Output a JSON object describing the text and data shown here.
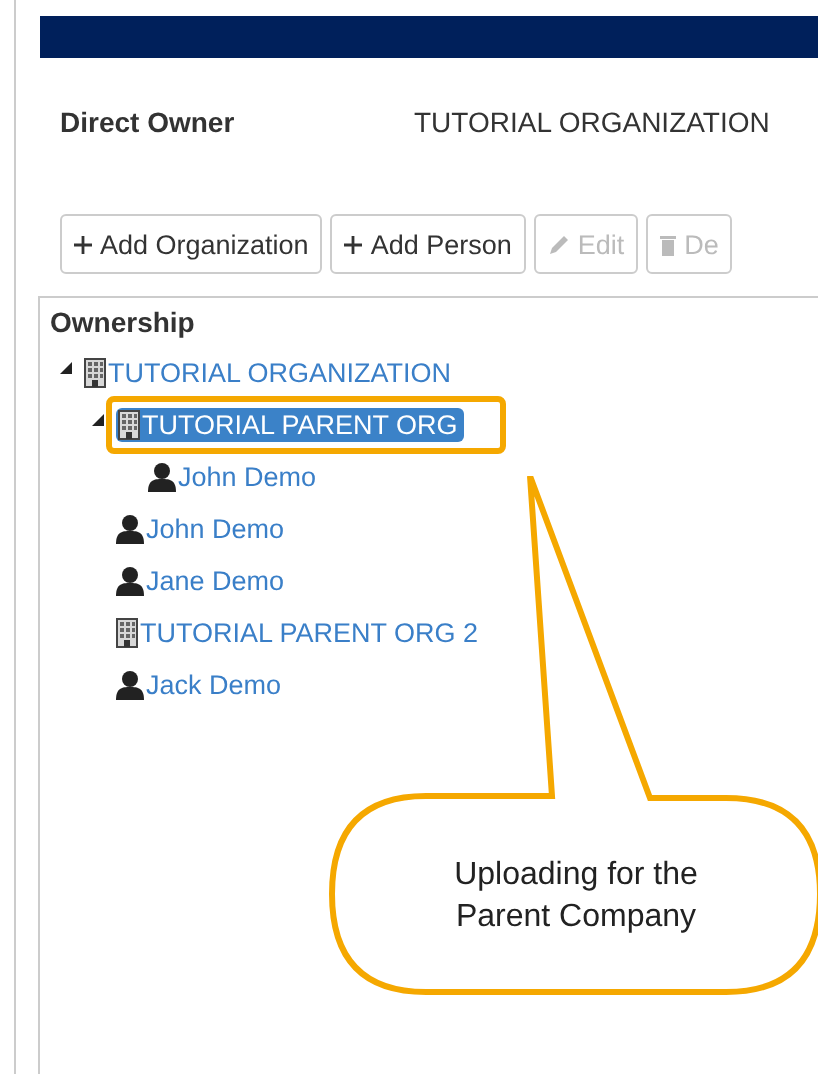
{
  "field": {
    "label": "Direct Owner",
    "value": "TUTORIAL ORGANIZATION"
  },
  "toolbar": [
    {
      "kind": "add",
      "label": "Add Organization",
      "disabled": false
    },
    {
      "kind": "add",
      "label": "Add Person",
      "disabled": false
    },
    {
      "kind": "edit",
      "label": "Edit",
      "disabled": true
    },
    {
      "kind": "delete",
      "label": "De",
      "disabled": true
    }
  ],
  "tree": {
    "title": "Ownership",
    "nodes": [
      {
        "kind": "org",
        "label": "TUTORIAL ORGANIZATION",
        "expanded": true,
        "selected": false,
        "highlighted": false,
        "children": [
          {
            "kind": "org",
            "label": "TUTORIAL PARENT ORG",
            "expanded": true,
            "selected": true,
            "highlighted": true,
            "children": [
              {
                "kind": "person",
                "label": "John Demo",
                "selected": false,
                "highlighted": false
              }
            ]
          },
          {
            "kind": "person",
            "label": "John Demo",
            "selected": false,
            "highlighted": false
          },
          {
            "kind": "person",
            "label": "Jane Demo",
            "selected": false,
            "highlighted": false
          },
          {
            "kind": "org",
            "label": "TUTORIAL PARENT ORG 2",
            "selected": false,
            "highlighted": false
          },
          {
            "kind": "person",
            "label": "Jack Demo",
            "selected": false,
            "highlighted": false
          }
        ]
      }
    ]
  },
  "callout": {
    "text": "Uploading for the Parent Company"
  }
}
